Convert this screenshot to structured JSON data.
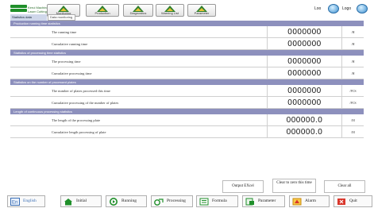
{
  "header": {
    "company_lines": [
      "Kerui Machinery",
      "Laser Cutting"
    ],
    "toolbar": [
      {
        "label": "Monitoring",
        "icon": "triangle-icon"
      },
      {
        "label": "Production",
        "icon": "triangle-icon"
      },
      {
        "label": "Diagnostics",
        "icon": "triangle-icon"
      },
      {
        "label": "Warning List",
        "icon": "triangle-icon"
      },
      {
        "label": "Parameter",
        "icon": "triangle-icon"
      }
    ],
    "user_label": "Loo",
    "logout_label": "Logo"
  },
  "tabs": [
    {
      "label": "Statistics data",
      "active": true
    },
    {
      "label": "Data monitoring",
      "active": false
    }
  ],
  "sections": [
    {
      "title": "Production running time statistics",
      "rows": [
        {
          "name": "The running time",
          "value": "0000000",
          "unit": "/H"
        },
        {
          "name": "Cumulative running time",
          "value": "0000000",
          "unit": "/H"
        }
      ]
    },
    {
      "title": "Statistics of processing time statistics",
      "rows": [
        {
          "name": "The processing time",
          "value": "0000000",
          "unit": "/H"
        },
        {
          "name": "Cumulative processing time",
          "value": "0000000",
          "unit": "/H"
        }
      ]
    },
    {
      "title": "Statistics on the number of processed plates",
      "rows": [
        {
          "name": "The number of plates processed this time",
          "value": "0000000",
          "unit": "/PCS"
        },
        {
          "name": "Cumulative processing of the number of plates",
          "value": "0000000",
          "unit": "/PCS"
        }
      ]
    },
    {
      "title": "Length of continuous processing statistics",
      "rows": [
        {
          "name": "The length of the processing plate",
          "value": "000000.0",
          "unit": "/M"
        },
        {
          "name": "Cumulative length processing of plate",
          "value": "000000.0",
          "unit": "/M"
        }
      ]
    }
  ],
  "actions": {
    "output_excel": "Output EXcel",
    "clear_this_time": "Clear to zero this time",
    "clear_all": "Clear all"
  },
  "nav": [
    {
      "label": "English",
      "icon": "language-icon"
    },
    {
      "label": "Initial",
      "icon": "home-icon"
    },
    {
      "label": "Running",
      "icon": "running-icon"
    },
    {
      "label": "Processing",
      "icon": "processing-icon"
    },
    {
      "label": "Formula",
      "icon": "formula-icon"
    },
    {
      "label": "Parameter",
      "icon": "parameter-icon"
    },
    {
      "label": "Alarm",
      "icon": "alarm-icon"
    },
    {
      "label": "Quit",
      "icon": "quit-icon"
    }
  ],
  "colors": {
    "section_header": "#8d90bd",
    "brand_green": "#1f8f2a",
    "quit_red": "#d9362b"
  }
}
